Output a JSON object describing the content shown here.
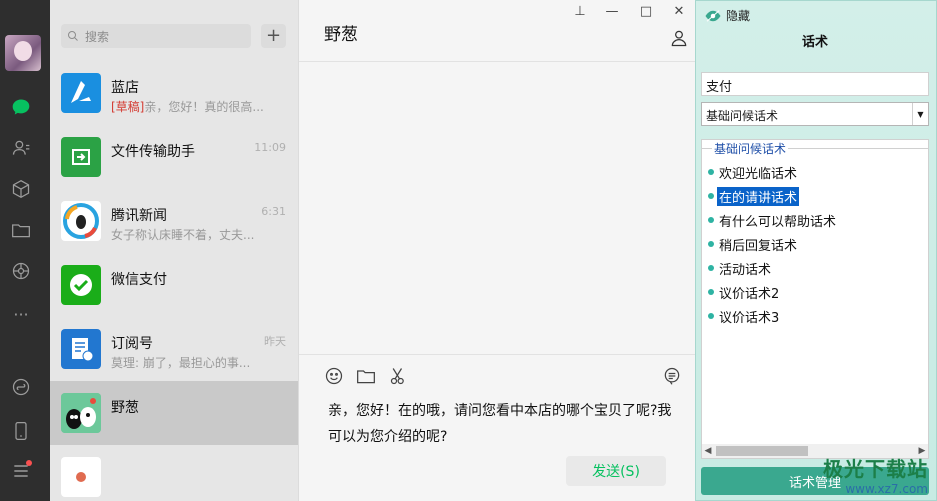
{
  "colors": {
    "accent": "#07c160",
    "rail_bg": "#2e2e2e",
    "selected_node": "#0a63c9",
    "panel_button": "#3aa88f"
  },
  "search": {
    "placeholder": "搜索"
  },
  "conversations": [
    {
      "name": "蓝店",
      "time": "",
      "draft_tag": "[草稿]",
      "preview": "亲，您好！真的很高..."
    },
    {
      "name": "文件传输助手",
      "time": "11:09",
      "preview": ""
    },
    {
      "name": "腾讯新闻",
      "time": "6:31",
      "preview": "女子称认床睡不着，丈夫..."
    },
    {
      "name": "微信支付",
      "time": "",
      "preview": ""
    },
    {
      "name": "订阅号",
      "time": "昨天",
      "preview": "莫理: 崩了，最担心的事..."
    },
    {
      "name": "野葱",
      "time": "",
      "preview": ""
    }
  ],
  "chat": {
    "title": "野葱",
    "window_controls": {
      "pin": "⊥",
      "minimize": "—",
      "maximize": "□",
      "close": "✕"
    },
    "input_text": "亲，您好！在的哦，请问您看中本店的哪个宝贝了呢?我可以为您介绍的呢?",
    "send_label": "发送(S)"
  },
  "panel": {
    "hide_label": "隐藏",
    "title": "话术",
    "keyword_value": "支付",
    "category_selected": "基础问候话术",
    "tree_header": "基础问候话术",
    "scripts": [
      "欢迎光临话术",
      "在的请讲话术",
      "有什么可以帮助话术",
      "稍后回复话术",
      "活动话术",
      "议价话术2",
      "议价话术3"
    ],
    "selected_index": 1,
    "manage_label": "话术管理"
  },
  "watermark": {
    "line1": "极光下载站",
    "line2": "www.xz7.com"
  }
}
